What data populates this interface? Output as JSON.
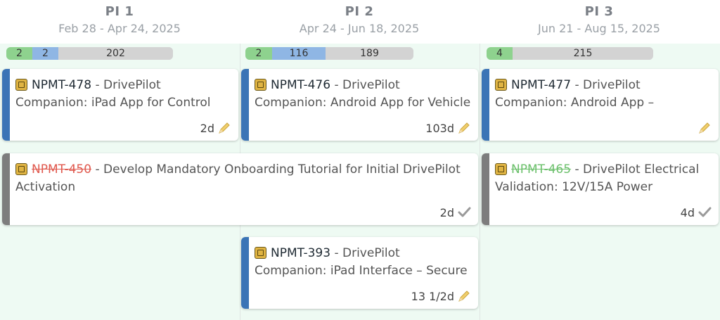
{
  "pis": [
    {
      "title": "PI 1",
      "dates": "Feb 28 - Apr 24, 2025",
      "bar": [
        "2",
        "2",
        "202"
      ]
    },
    {
      "title": "PI 2",
      "dates": "Apr 24 - Jun 18, 2025",
      "bar": [
        "2",
        "116",
        "189"
      ]
    },
    {
      "title": "PI 3",
      "dates": "Jun 21 - Aug 15, 2025",
      "bar": [
        "4",
        "215"
      ]
    }
  ],
  "cards": [
    {
      "key": "NPMT-478",
      "sep": " - ",
      "title": "DrivePilot Companion: iPad App for Control",
      "estimate": "2d",
      "icon": "pencil-icon"
    },
    {
      "key": "NPMT-476",
      "sep": " - ",
      "title": "DrivePilot Companion: Android App for Vehicle",
      "estimate": "103d",
      "icon": "pencil-icon"
    },
    {
      "key": "NPMT-477",
      "sep": " - ",
      "title": "DrivePilot Companion: Android App –",
      "estimate": "",
      "icon": "pencil-icon"
    },
    {
      "key": "NPMT-450",
      "sep": " - ",
      "title": "Develop Mandatory Onboarding Tutorial for Initial DrivePilot Activation",
      "estimate": "2d",
      "icon": "check-icon"
    },
    {
      "key": "NPMT-465",
      "sep": " - ",
      "title": "DrivePilot Electrical Validation: 12V/15A Power",
      "estimate": "4d",
      "icon": "check-icon"
    },
    {
      "key": "NPMT-393",
      "sep": " - ",
      "title": "DrivePilot Companion: iPad Interface – Secure",
      "estimate": "13 1/2d",
      "icon": "pencil-icon"
    }
  ],
  "colors": {
    "board_bg": "#eefaf3",
    "stripe_blue": "#3b74b6",
    "stripe_gray": "#7d7d7d",
    "bar_green": "#8ed28e",
    "bar_blue": "#8fb6e4",
    "bar_gray": "#d3d3d3",
    "done_red": "#e05a4f",
    "done_green": "#6cc06c"
  }
}
